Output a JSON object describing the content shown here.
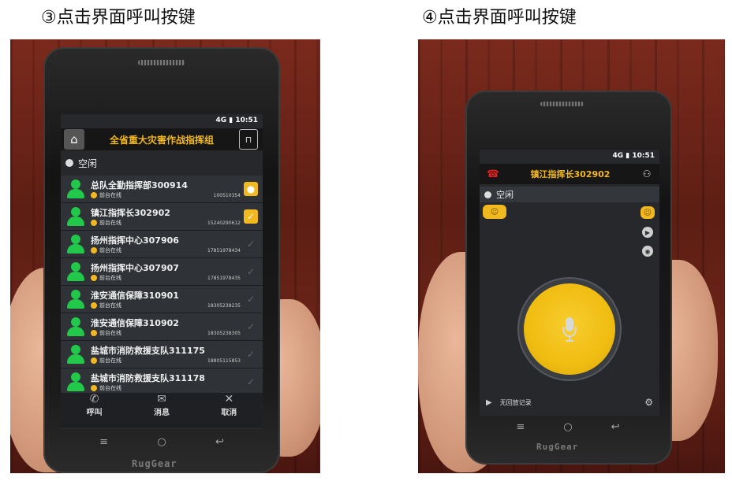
{
  "captions": {
    "left": "③点击界面呼叫按键",
    "right": "④点击界面呼叫按键"
  },
  "left_phone": {
    "status_bar": {
      "network": "4G",
      "time": "10:51"
    },
    "header": {
      "title": "全省重大灾害作战指挥组",
      "home_icon": "home-icon",
      "unlock_icon": "unlock-icon"
    },
    "idle_label": "空闲",
    "members": [
      {
        "name": "总队全勤指挥部300914",
        "status": "前台在线",
        "number": "100510354",
        "checked": false,
        "badge": "mic"
      },
      {
        "name": "镇江指挥长302902",
        "status": "前台在线",
        "number": "15240290612",
        "checked": true
      },
      {
        "name": "扬州指挥中心307906",
        "status": "前台在线",
        "number": "17851978434",
        "checked": false
      },
      {
        "name": "扬州指挥中心307907",
        "status": "前台在线",
        "number": "17851978435",
        "checked": false
      },
      {
        "name": "淮安通信保障310901",
        "status": "前台在线",
        "number": "18305238235",
        "checked": false
      },
      {
        "name": "淮安通信保障310902",
        "status": "前台在线",
        "number": "18305238305",
        "checked": false
      },
      {
        "name": "盐城市消防救援支队311175",
        "status": "前台在线",
        "number": "18805115853",
        "checked": false
      },
      {
        "name": "盐城市消防救援支队311178",
        "status": "前台在线",
        "number": "",
        "checked": false
      }
    ],
    "actions": [
      {
        "label": "呼叫",
        "icon": "phone-icon"
      },
      {
        "label": "消息",
        "icon": "mail-icon"
      },
      {
        "label": "取消",
        "icon": "close-icon"
      }
    ],
    "brand": "RugGear"
  },
  "right_phone": {
    "status_bar": {
      "network": "4G",
      "time": "10:51"
    },
    "header": {
      "title": "镇江指挥长302902",
      "hangup_icon": "hangup-icon",
      "add_user_icon": "add-user-icon"
    },
    "idle_label": "空闲",
    "talk_icon": "microphone-icon",
    "record_label": "无回放记录",
    "brand": "RugGear"
  },
  "colors": {
    "accent": "#f2b820",
    "online": "#22c84a",
    "screen": "#26282c",
    "hangup": "#e02020"
  }
}
